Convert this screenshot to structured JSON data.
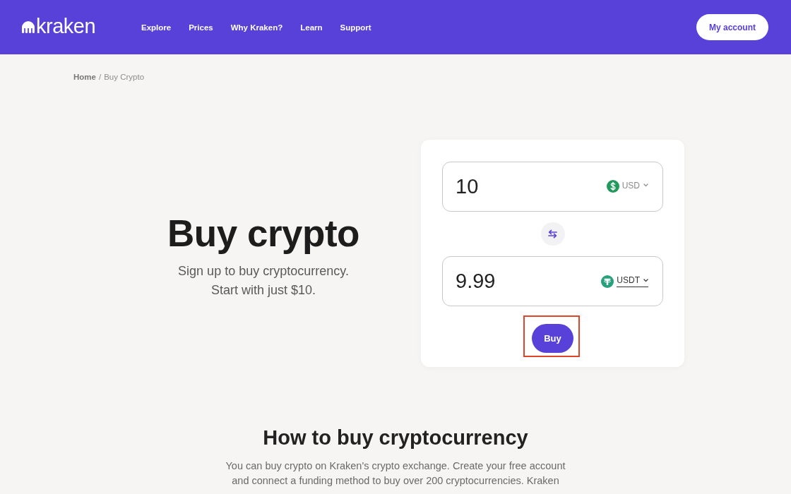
{
  "header": {
    "logo": "kraken",
    "nav": [
      "Explore",
      "Prices",
      "Why Kraken?",
      "Learn",
      "Support"
    ],
    "account_button": "My account"
  },
  "breadcrumb": {
    "items": [
      {
        "label": "Home",
        "current": false
      },
      {
        "label": "Buy Crypto",
        "current": true
      }
    ],
    "separator": "/"
  },
  "hero": {
    "title": "Buy crypto",
    "subtitle": "Sign up to buy cryptocurrency.\nStart with just $10."
  },
  "converter": {
    "fields": [
      {
        "value": "10",
        "currency": {
          "code": "USD",
          "kind": "usd",
          "focused": false
        }
      },
      {
        "value": "9.99",
        "currency": {
          "code": "USDT",
          "kind": "tether",
          "focused": true
        }
      }
    ],
    "buy_button": {
      "label": "Buy",
      "highlighted": true
    }
  },
  "how_to": {
    "title": "How to buy cryptocurrency",
    "text": "You can buy crypto on Kraken's crypto exchange. Create your free account\nand connect a funding method to buy over 200 cryptocurrencies. Kraken"
  }
}
